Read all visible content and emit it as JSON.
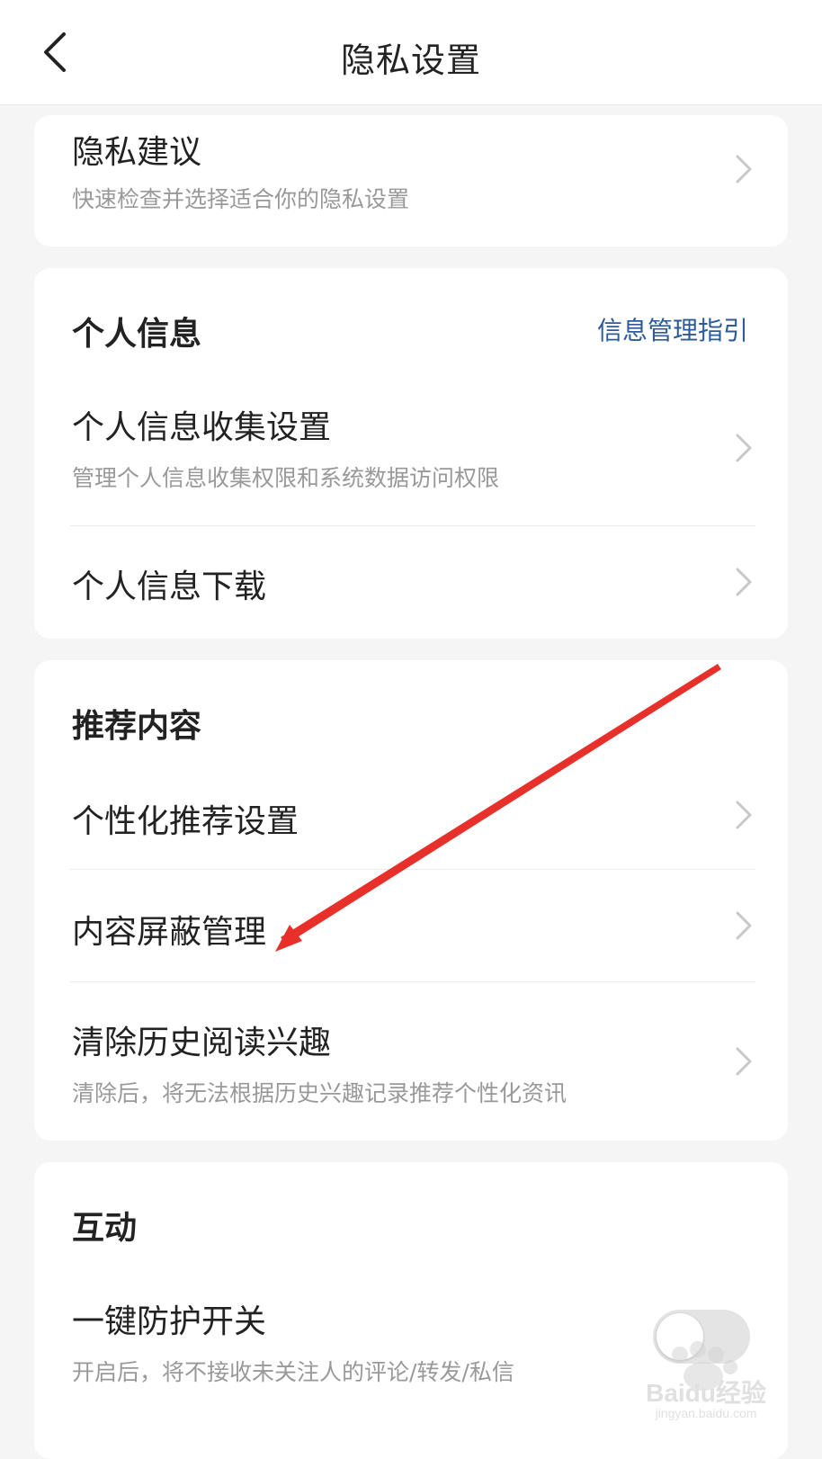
{
  "header": {
    "title": "隐私设置",
    "back_icon": "chevron-left-icon"
  },
  "privacy_suggestion": {
    "title": "隐私建议",
    "subtitle": "快速检查并选择适合你的隐私设置"
  },
  "personal_info": {
    "heading": "个人信息",
    "link": "信息管理指引",
    "items": [
      {
        "title": "个人信息收集设置",
        "subtitle": "管理个人信息收集权限和系统数据访问权限"
      },
      {
        "title": "个人信息下载"
      }
    ]
  },
  "recommended": {
    "heading": "推荐内容",
    "items": [
      {
        "title": "个性化推荐设置"
      },
      {
        "title": "内容屏蔽管理"
      },
      {
        "title": "清除历史阅读兴趣",
        "subtitle": "清除后，将无法根据历史兴趣记录推荐个性化资讯"
      }
    ]
  },
  "interaction": {
    "heading": "互动",
    "items": [
      {
        "title": "一键防护开关",
        "subtitle": "开启后，将不接收未关注人的评论/转发/私信",
        "toggle_on": false
      }
    ]
  },
  "annotation": {
    "color": "#e8302a"
  },
  "watermark": {
    "brand": "Baidu经验",
    "url": "jingyan.baidu.com"
  },
  "colors": {
    "link": "#2d5a9a",
    "background": "#f5f5f5",
    "card": "#ffffff",
    "subtext": "#999999"
  }
}
